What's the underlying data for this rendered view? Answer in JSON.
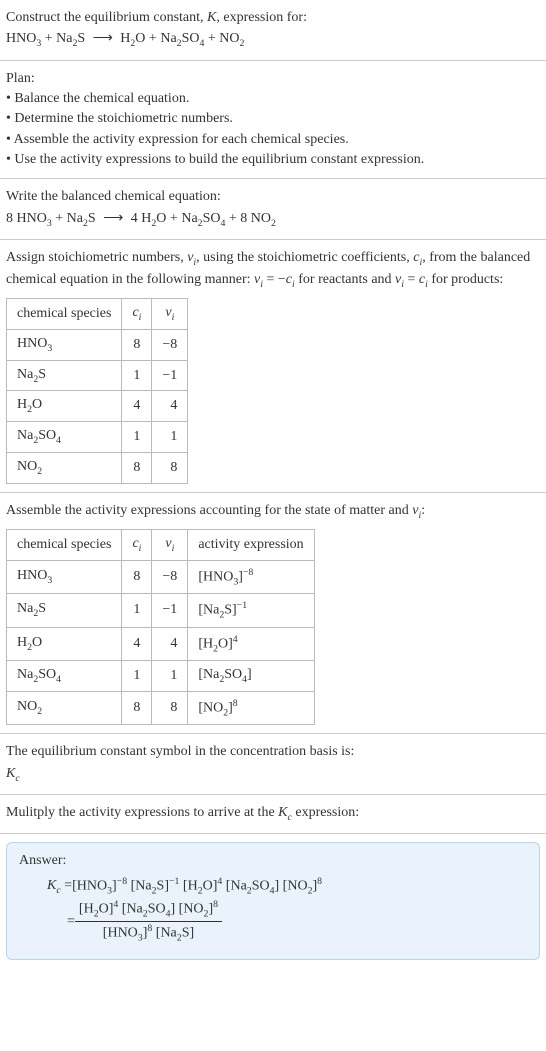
{
  "intro": {
    "line1_pre": "Construct the equilibrium constant, ",
    "line1_K": "K",
    "line1_post": ", expression for:"
  },
  "reaction_unbalanced": {
    "r1": {
      "base": "HNO",
      "sub": "3"
    },
    "plus1": " + ",
    "r2": {
      "base": "Na",
      "sub": "2",
      "tail": "S"
    },
    "arrow": "⟶",
    "p1": {
      "base": "H",
      "sub": "2",
      "tail": "O"
    },
    "plus2": " + ",
    "p2": {
      "base": "Na",
      "sub": "2",
      "mid": "SO",
      "sub2": "4"
    },
    "plus3": " + ",
    "p3": {
      "base": "NO",
      "sub": "2"
    }
  },
  "plan": {
    "title": "Plan:",
    "b1": "• Balance the chemical equation.",
    "b2": "• Determine the stoichiometric numbers.",
    "b3": "• Assemble the activity expression for each chemical species.",
    "b4": "• Use the activity expressions to build the equilibrium constant expression."
  },
  "balanced": {
    "title": "Write the balanced chemical equation:",
    "c1": "8 ",
    "s1": {
      "base": "HNO",
      "sub": "3"
    },
    "plus1": " + ",
    "s2": {
      "base": "Na",
      "sub": "2",
      "tail": "S"
    },
    "arrow": "⟶",
    "c3": "4 ",
    "s3": {
      "base": "H",
      "sub": "2",
      "tail": "O"
    },
    "plus2": " + ",
    "s4": {
      "base": "Na",
      "sub": "2",
      "mid": "SO",
      "sub2": "4"
    },
    "plus3": " + ",
    "c5": "8 ",
    "s5": {
      "base": "NO",
      "sub": "2"
    }
  },
  "assign": {
    "text_a": "Assign stoichiometric numbers, ",
    "nu": "ν",
    "sub_i": "i",
    "text_b": ", using the stoichiometric coefficients, ",
    "c": "c",
    "text_c": ", from the balanced chemical equation in the following manner: ",
    "rel1_a": "ν",
    "rel1_b": " = −",
    "rel1_c": "c",
    "rel1_d": " for reactants and ",
    "rel2_a": "ν",
    "rel2_b": " = ",
    "rel2_c": "c",
    "rel2_d": " for products:"
  },
  "table1": {
    "h1": "chemical species",
    "h2": "c",
    "h2sub": "i",
    "h3": "ν",
    "h3sub": "i",
    "rows": [
      {
        "sp": {
          "base": "HNO",
          "sub": "3"
        },
        "c": "8",
        "v": "−8"
      },
      {
        "sp": {
          "base": "Na",
          "sub": "2",
          "tail": "S"
        },
        "c": "1",
        "v": "−1"
      },
      {
        "sp": {
          "base": "H",
          "sub": "2",
          "tail": "O"
        },
        "c": "4",
        "v": "4"
      },
      {
        "sp": {
          "base": "Na",
          "sub": "2",
          "mid": "SO",
          "sub2": "4"
        },
        "c": "1",
        "v": "1"
      },
      {
        "sp": {
          "base": "NO",
          "sub": "2"
        },
        "c": "8",
        "v": "8"
      }
    ]
  },
  "assemble": {
    "text_a": "Assemble the activity expressions accounting for the state of matter and ",
    "nu": "ν",
    "sub_i": "i",
    "text_b": ":"
  },
  "table2": {
    "h1": "chemical species",
    "h2": "c",
    "h2sub": "i",
    "h3": "ν",
    "h3sub": "i",
    "h4": "activity expression",
    "rows": [
      {
        "sp": {
          "base": "HNO",
          "sub": "3"
        },
        "c": "8",
        "v": "−8",
        "act": {
          "l": "[HNO",
          "sub": "3",
          "r": "]",
          "sup": "−8"
        }
      },
      {
        "sp": {
          "base": "Na",
          "sub": "2",
          "tail": "S"
        },
        "c": "1",
        "v": "−1",
        "act": {
          "l": "[Na",
          "sub": "2",
          "mid": "S]",
          "sup": "−1"
        }
      },
      {
        "sp": {
          "base": "H",
          "sub": "2",
          "tail": "O"
        },
        "c": "4",
        "v": "4",
        "act": {
          "l": "[H",
          "sub": "2",
          "mid": "O]",
          "sup": "4"
        }
      },
      {
        "sp": {
          "base": "Na",
          "sub": "2",
          "mid": "SO",
          "sub2": "4"
        },
        "c": "1",
        "v": "1",
        "act": {
          "l": "[Na",
          "sub": "2",
          "mid": "SO",
          "sub2": "4",
          "r": "]"
        }
      },
      {
        "sp": {
          "base": "NO",
          "sub": "2"
        },
        "c": "8",
        "v": "8",
        "act": {
          "l": "[NO",
          "sub": "2",
          "r": "]",
          "sup": "8"
        }
      }
    ]
  },
  "symbol": {
    "line1": "The equilibrium constant symbol in the concentration basis is:",
    "K": "K",
    "sub": "c"
  },
  "multiply": {
    "text_a": "Mulitply the activity expressions to arrive at the ",
    "K": "K",
    "sub": "c",
    "text_b": " expression:"
  },
  "answer": {
    "title": "Answer:",
    "K": "K",
    "sub": "c",
    "eq": " = ",
    "line1": {
      "t1": "[HNO",
      "s1": "3",
      "t2": "]",
      "p1": "−8",
      "t3": " [Na",
      "s3": "2",
      "t4": "S]",
      "p2": "−1",
      "t5": " [H",
      "s5": "2",
      "t6": "O]",
      "p3": "4",
      "t7": " [Na",
      "s7": "2",
      "t8": "SO",
      "s8": "4",
      "t9": "] [NO",
      "s9": "2",
      "t10": "]",
      "p4": "8"
    },
    "eq2": "= ",
    "num": {
      "t1": "[H",
      "s1": "2",
      "t2": "O]",
      "p1": "4",
      "t3": " [Na",
      "s3": "2",
      "t4": "SO",
      "s4": "4",
      "t5": "] [NO",
      "s5": "2",
      "t6": "]",
      "p2": "8"
    },
    "den": {
      "t1": "[HNO",
      "s1": "3",
      "t2": "]",
      "p1": "8",
      "t3": " [Na",
      "s3": "2",
      "t4": "S]"
    }
  }
}
